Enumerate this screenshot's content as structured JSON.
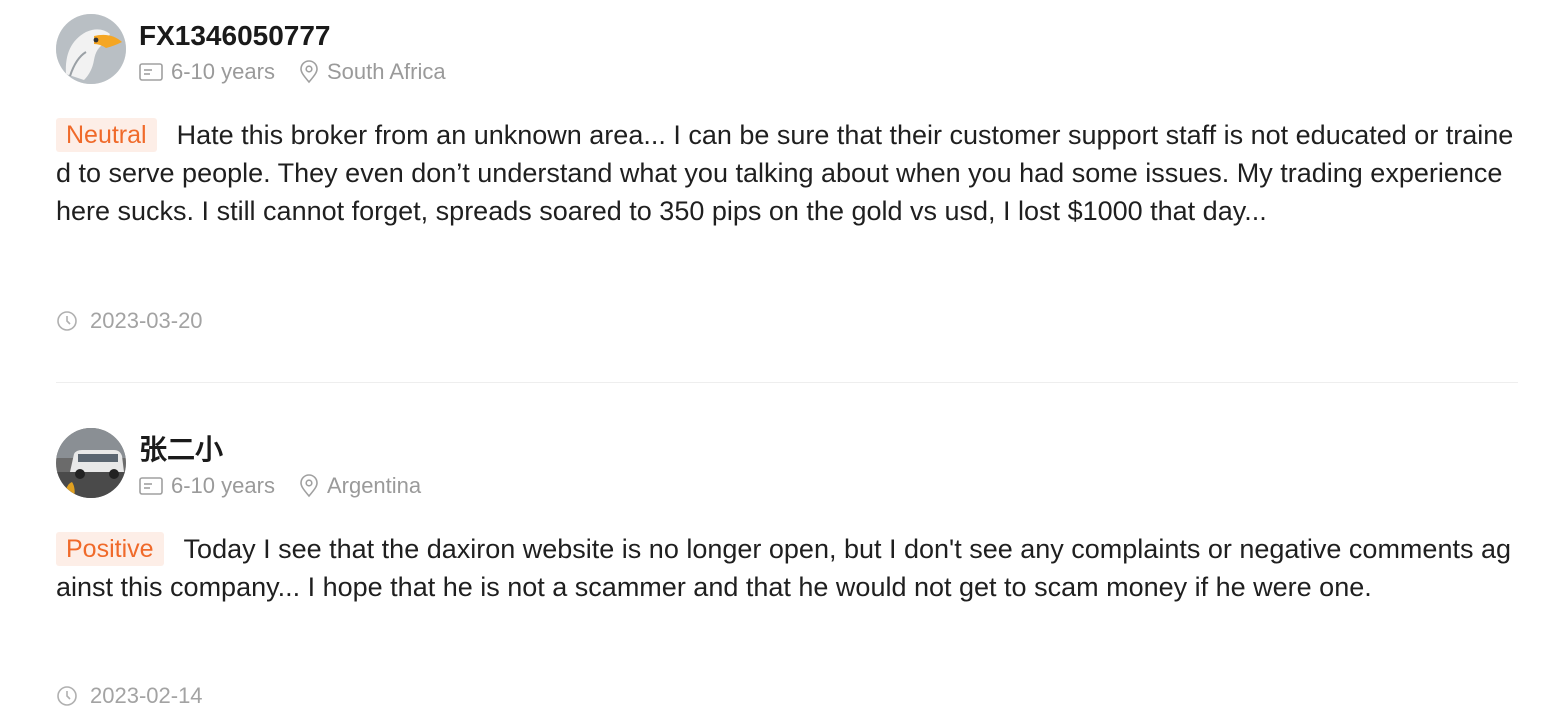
{
  "reviews": [
    {
      "user": "FX1346050777",
      "experience": "6-10 years",
      "location": "South Africa",
      "tag": "Neutral",
      "text": "Hate this broker from an unknown area... I can be sure that their customer support staff is not educated or trained to serve people. They even don’t understand what you talking about when you had some issues. My trading experience here sucks. I still cannot forget, spreads soared to 350 pips on the gold vs usd, I lost $1000 that day...",
      "date": "2023-03-20"
    },
    {
      "user": "张二小",
      "experience": "6-10 years",
      "location": "Argentina",
      "tag": "Positive",
      "text": "Today I see that the daxiron website is no longer open, but I don't see any complaints or negative comments against this company... I hope that he is not a scammer and that he would not get to scam money if he were one.",
      "date": "2023-02-14"
    }
  ]
}
